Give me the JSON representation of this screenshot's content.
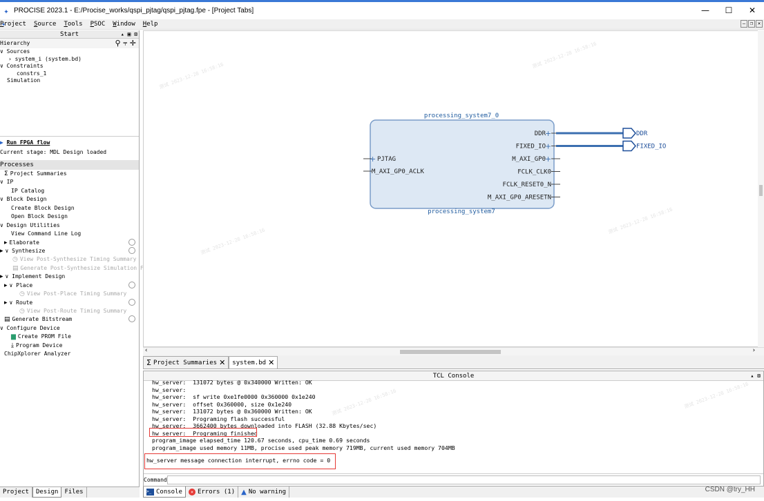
{
  "window": {
    "title": "PROCISE 2023.1  - E:/Procise_works/qspi_pjtag/qspi_pjtag.fpe - [Project Tabs]",
    "controls": [
      "—",
      "☐",
      "✕"
    ]
  },
  "menu": {
    "items": [
      "Project",
      "Source",
      "Tools",
      "PSOC",
      "Window",
      "Help"
    ]
  },
  "left": {
    "start_title": "Start",
    "hierarchy_label": "Hierarchy",
    "tree": [
      {
        "text": "∨ Sources",
        "indent": 0
      },
      {
        "text": "› system_i (system.bd)",
        "indent": 12
      },
      {
        "text": "∨ Constraints",
        "indent": 0
      },
      {
        "text": "constrs_1",
        "indent": 24
      },
      {
        "text": "Simulation",
        "indent": 10
      }
    ],
    "run_flow": "Run FPGA flow",
    "current_stage": "Current stage: MDL Design loaded",
    "processes_label": "Processes",
    "processes": [
      {
        "text": "Project Summaries",
        "indent": 6,
        "icon": "sigma-icon",
        "gray": false,
        "circle": false
      },
      {
        "text": "∨ IP",
        "indent": 0,
        "icon": "",
        "gray": false,
        "circle": false
      },
      {
        "text": "IP Catalog",
        "indent": 16,
        "icon": "",
        "gray": false,
        "circle": false
      },
      {
        "text": "∨ Block Design",
        "indent": 0,
        "icon": "",
        "gray": false,
        "circle": false
      },
      {
        "text": "Create Block Design",
        "indent": 16,
        "icon": "",
        "gray": false,
        "circle": false
      },
      {
        "text": "Open Block Design",
        "indent": 16,
        "icon": "",
        "gray": false,
        "circle": false
      },
      {
        "text": "∨ Design Utilities",
        "indent": 0,
        "icon": "",
        "gray": false,
        "circle": false
      },
      {
        "text": "View Command Line Log",
        "indent": 16,
        "icon": "",
        "gray": false,
        "circle": false
      },
      {
        "text": "Elaborate",
        "indent": 6,
        "icon": "run-icon",
        "gray": false,
        "circle": true
      },
      {
        "text": "∨ Synthesize",
        "indent": 0,
        "icon": "run-icon",
        "gray": false,
        "circle": true
      },
      {
        "text": "View Post-Synthesize Timing Summary",
        "indent": 18,
        "icon": "clock-icon",
        "gray": true,
        "circle": false
      },
      {
        "text": "Generate Post-Synthesize Simulation File",
        "indent": 18,
        "icon": "file-icon",
        "gray": true,
        "circle": false
      },
      {
        "text": "∨ Implement Design",
        "indent": 0,
        "icon": "run-icon",
        "gray": false,
        "circle": false
      },
      {
        "text": "∨ Place",
        "indent": 6,
        "icon": "run-icon",
        "gray": false,
        "circle": true
      },
      {
        "text": "View Post-Place Timing Summary",
        "indent": 28,
        "icon": "clock-icon",
        "gray": true,
        "circle": false
      },
      {
        "text": "∨ Route",
        "indent": 6,
        "icon": "run-icon",
        "gray": false,
        "circle": true
      },
      {
        "text": "View Post-Route Timing Summary",
        "indent": 28,
        "icon": "clock-icon",
        "gray": true,
        "circle": false
      },
      {
        "text": "Generate Bitstream",
        "indent": 6,
        "icon": "file-icon",
        "gray": false,
        "circle": true
      },
      {
        "text": "∨ Configure Device",
        "indent": 0,
        "icon": "",
        "gray": false,
        "circle": false
      },
      {
        "text": "Create PROM File",
        "indent": 16,
        "icon": "prom-icon",
        "gray": false,
        "circle": false
      },
      {
        "text": "Program Device",
        "indent": 16,
        "icon": "download-icon",
        "gray": false,
        "circle": false
      },
      {
        "text": "ChipXplorer Analyzer",
        "indent": 6,
        "icon": "",
        "gray": false,
        "circle": false
      }
    ],
    "tabs": [
      "Project",
      "Design",
      "Files"
    ],
    "active_tab": "Design"
  },
  "diagram": {
    "block_title": "processing_system7_0",
    "block_subtitle": "processing_system7",
    "left_ports": [
      "PJTAG",
      "M_AXI_GP0_ACLK"
    ],
    "right_ports": [
      "DDR",
      "FIXED_IO",
      "M_AXI_GP0",
      "FCLK_CLK0",
      "FCLK_RESET0_N",
      "M_AXI_GP0_ARESETN"
    ],
    "external_ports": [
      "DDR",
      "FIXED_IO"
    ],
    "block_fill": "#dde8f4",
    "block_stroke": "#7a9cc8",
    "wire_color": "#3b6fb0"
  },
  "editor_tabs": [
    {
      "label": "Project Summaries",
      "active": false
    },
    {
      "label": "system.bd",
      "active": true
    }
  ],
  "console": {
    "title": "TCL Console",
    "lines": [
      "hw_server:  131072 bytes @ 0x340000 Written: OK",
      "hw_server:",
      "hw_server:  sf write 0xe1fe0000 0x360000 0x1e240",
      "hw_server:  offset 0x360000, size 0x1e240",
      "hw_server:  131072 bytes @ 0x360000 Written: OK",
      "hw_server:  Programing flash successful",
      "hw_server:  3662400 bytes downloaded into FLASH (32.88 Kbytes/sec)",
      "hw_server:  Programing finished",
      "program_image elapsed_time 120.67 seconds, cpu_time 0.69 seconds",
      "program_image used memory 11MB, procise used peak memory 719MB, current used memory 704MB"
    ],
    "message": "hw_server message connection interrupt, errno code = 0",
    "command_label": "Command>",
    "command_value": ""
  },
  "bottom_tabs": [
    {
      "label": "Console",
      "icon": "console-icon",
      "active": true
    },
    {
      "label": "Errors (1)",
      "icon": "error-icon",
      "active": false
    },
    {
      "label": "No warning",
      "icon": "warning-icon",
      "active": false
    }
  ],
  "watermark": "CSDN @try_HH"
}
